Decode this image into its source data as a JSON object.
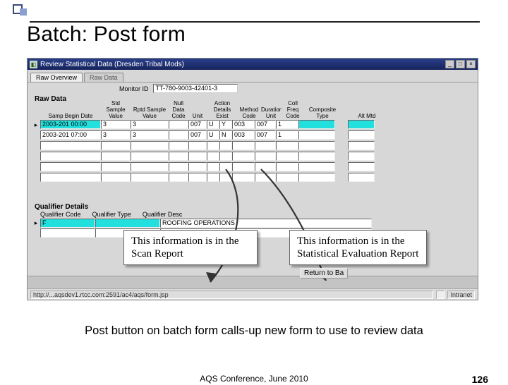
{
  "slide": {
    "title": "Batch: Post form",
    "caption": "Post button on batch form calls-up new form to use to review data",
    "footer_center": "AQS Conference, June 2010",
    "page_number": "126"
  },
  "window": {
    "title": "Review Statistical Data (Dresden Tribal Mods)",
    "tabs": [
      "Raw Overview",
      "Raw Data"
    ],
    "monitor_label": "Monitor ID",
    "monitor_value": "TT-780-9003-42401-3",
    "raw_label": "Raw Data",
    "columns": {
      "date": "Samp Begin Date",
      "sv": "Std Sample\nValue",
      "rs": "Rptd Sample\nValue",
      "ndc": "Null\nData\nCode",
      "unit": "Unit",
      "ae": "Action Details\nExist",
      "meth": "Method\nCode",
      "dur": "Duration\nUnit",
      "cf": "Coll Freq\nCode",
      "ctype": "Composite\nType",
      "alt": "Alt Mtd"
    },
    "rows": [
      {
        "date": "2003-201 00:00",
        "sv": "3",
        "rs": "3",
        "ndc": "",
        "unit": "007",
        "u2": "U",
        "ae": "Y",
        "meth": "003",
        "dur": "007",
        "cf": "1",
        "ctype": "",
        "alt": ""
      },
      {
        "date": "2003-201 07:00",
        "sv": "3",
        "rs": "3",
        "ndc": "",
        "unit": "007",
        "u2": "U",
        "ae": "N",
        "meth": "003",
        "dur": "007",
        "cf": "1",
        "ctype": "",
        "alt": ""
      }
    ],
    "qualifier": {
      "label": "Qualifier Details",
      "head": [
        "Qualifier Code",
        "Qualifier Type",
        "Qualifier Desc"
      ],
      "row": {
        "code": "F",
        "type": "",
        "desc": "ROOFING OPERATIONS"
      }
    },
    "return_label": "Return to Ba",
    "status_path": "http://...aqsdev1.rtcc.com:2591/ac4/aqs/form.jsp"
  },
  "callouts": {
    "left": "This information is in the Scan Report",
    "right": "This information is in the Statistical Evaluation Report"
  }
}
